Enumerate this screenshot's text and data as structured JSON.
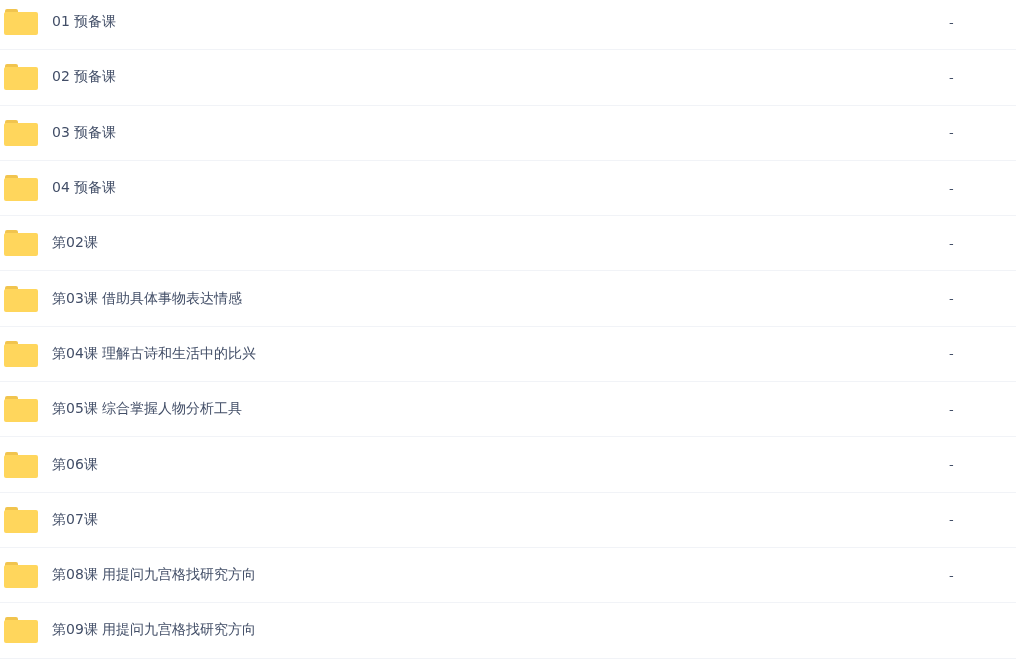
{
  "files": [
    {
      "name": "01 预备课",
      "size": "-"
    },
    {
      "name": "02 预备课",
      "size": "-"
    },
    {
      "name": "03 预备课",
      "size": "-"
    },
    {
      "name": "04 预备课",
      "size": "-"
    },
    {
      "name": "第02课",
      "size": "-"
    },
    {
      "name": "第03课 借助具体事物表达情感",
      "size": "-"
    },
    {
      "name": "第04课 理解古诗和生活中的比兴",
      "size": "-"
    },
    {
      "name": "第05课 综合掌握人物分析工具",
      "size": "-"
    },
    {
      "name": "第06课",
      "size": "-"
    },
    {
      "name": "第07课",
      "size": "-"
    },
    {
      "name": "第08课 用提问九宫格找研究方向",
      "size": "-"
    },
    {
      "name": "第09课 用提问九宫格找研究方向"
    }
  ]
}
